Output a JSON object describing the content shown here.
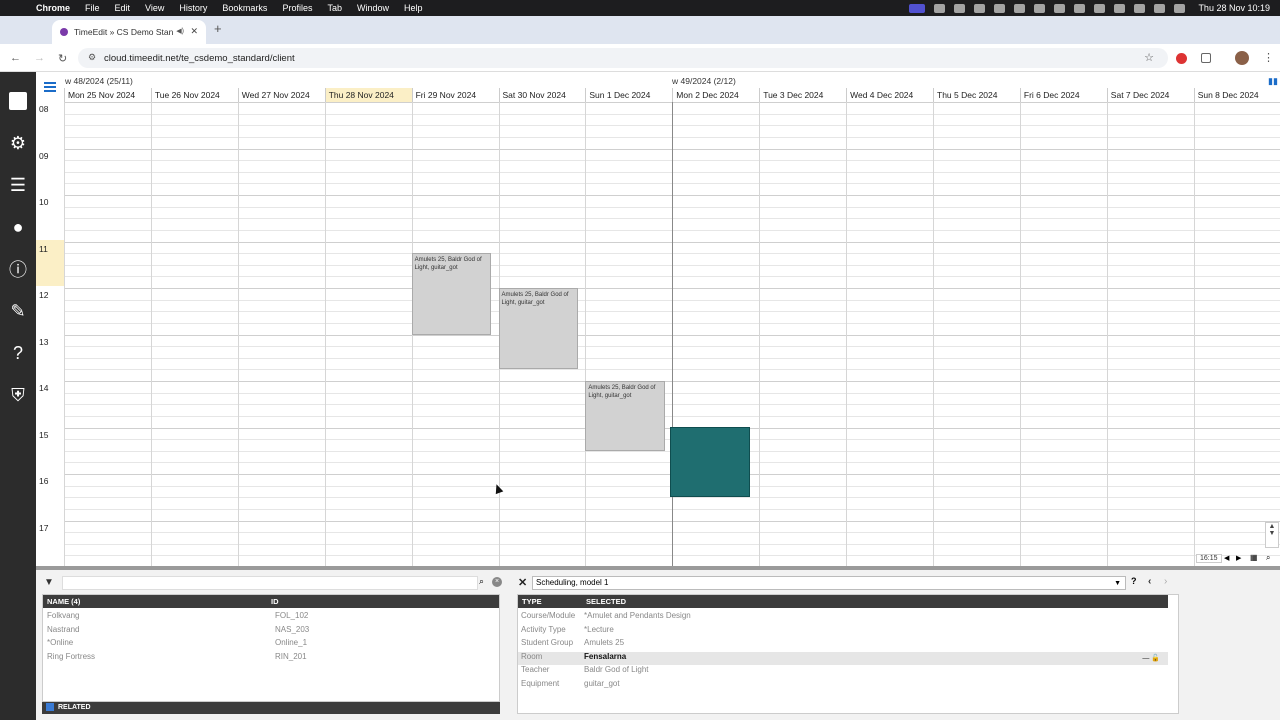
{
  "menubar": {
    "app": "Chrome",
    "items": [
      "File",
      "Edit",
      "View",
      "History",
      "Bookmarks",
      "Profiles",
      "Tab",
      "Window",
      "Help"
    ],
    "clock": "Thu 28 Nov  10:19"
  },
  "browser": {
    "tab_title": "TimeEdit » CS Demo Stan",
    "url": "cloud.timeedit.net/te_csdemo_standard/client"
  },
  "calendar": {
    "weeks": [
      "w 48/2024 (25/11)",
      "w 49/2024 (2/12)"
    ],
    "days": [
      "Mon 25 Nov 2024",
      "Tue 26 Nov 2024",
      "Wed 27 Nov 2024",
      "Thu 28 Nov 2024",
      "Fri 29 Nov 2024",
      "Sat 30 Nov 2024",
      "Sun 1 Dec 2024",
      "Mon 2 Dec 2024",
      "Tue 3 Dec 2024",
      "Wed 4 Dec 2024",
      "Thu 5 Dec 2024",
      "Fri 6 Dec 2024",
      "Sat 7 Dec 2024",
      "Sun 8 Dec 2024"
    ],
    "hours": [
      "08",
      "09",
      "10",
      "11",
      "12",
      "13",
      "14",
      "15",
      "16",
      "17"
    ],
    "bookings": [
      {
        "text": "Amulets 25, Baldr God of Light, guitar_got",
        "day": "Fri 29 Nov 2024",
        "start": "11:15",
        "end": "13:00"
      },
      {
        "text": "Amulets 25, Baldr God of Light, guitar_got",
        "day": "Sat 30 Nov 2024",
        "start": "12:00",
        "end": "13:45"
      },
      {
        "text": "Amulets 25, Baldr God of Light, guitar_got",
        "day": "Sun 1 Dec 2024",
        "start": "14:00",
        "end": "15:30"
      }
    ],
    "time_display": "16:15"
  },
  "objects": {
    "col_name": "NAME (4)",
    "col_id": "ID",
    "rows": [
      {
        "name": "Folkvang",
        "id": "FOL_102"
      },
      {
        "name": "Nastrand",
        "id": "NAS_203"
      },
      {
        "name": "*Online",
        "id": "Online_1"
      },
      {
        "name": "Ring Fortress",
        "id": "RIN_201"
      }
    ],
    "related_label": "RELATED"
  },
  "scheduling": {
    "model": "Scheduling, model 1",
    "col_type": "TYPE",
    "col_selected": "SELECTED",
    "rows": [
      {
        "type": "Course/Module",
        "value": "*Amulet and Pendants Design"
      },
      {
        "type": "Activity Type",
        "value": "*Lecture"
      },
      {
        "type": "Student Group",
        "value": "Amulets 25"
      },
      {
        "type": "Room",
        "value": "Fensalarna"
      },
      {
        "type": "Teacher",
        "value": "Baldr God of Light"
      },
      {
        "type": "Equipment",
        "value": "guitar_got"
      }
    ]
  },
  "colors": {
    "sidebar": "#2c2c2c",
    "today_highlight": "#fbefc6",
    "selected_booking": "#1f6e70",
    "booking": "#d2d2d2"
  }
}
